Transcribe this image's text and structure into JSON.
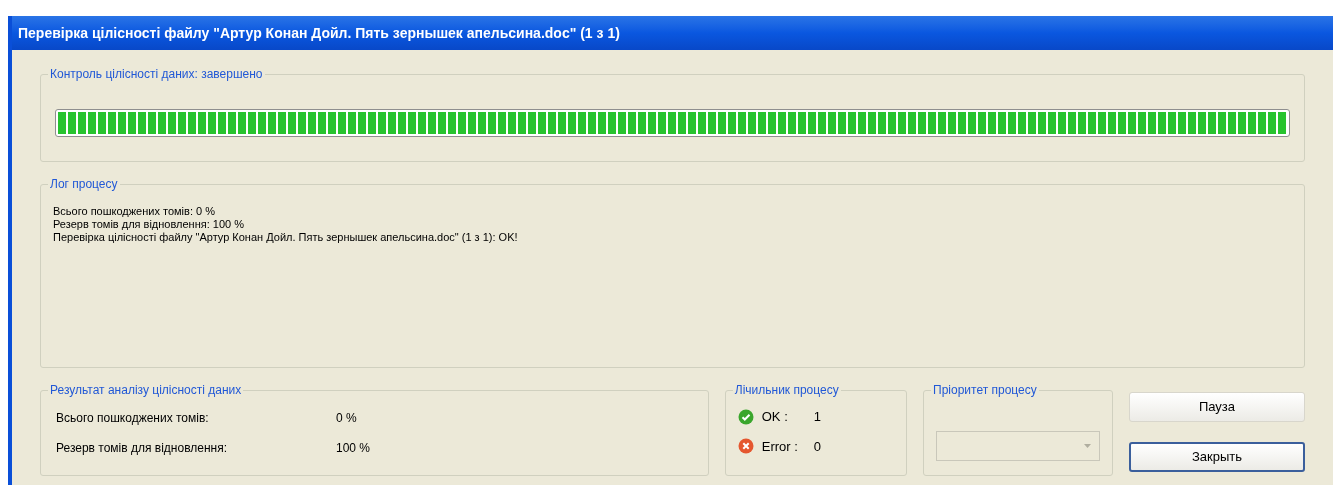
{
  "window": {
    "title": "Перевірка цілісності файлу \"Артур Конан Дойл. Пять зернышек апельсина.doc\" (1 з 1)"
  },
  "progress": {
    "label": "Контроль цілісності даних: завершено",
    "level": 1
  },
  "log": {
    "label": "Лог процесу",
    "lines": [
      "Всього пошкоджених томів: 0 %",
      "Резерв томів для відновлення: 100 %",
      "Перевірка цілісності файлу \"Артур Конан Дойл. Пять зернышек апельсина.doc\" (1 з 1): OK!"
    ]
  },
  "result": {
    "label": "Результат аналізу цілісності даних",
    "rows": [
      {
        "name": "Всього пошкоджених томів:",
        "value": "0 %"
      },
      {
        "name": "Резерв томів для відновлення:",
        "value": "100 %"
      }
    ]
  },
  "counter": {
    "label": "Лічильник процесу",
    "items": [
      {
        "kind": "ok",
        "name": "OK :",
        "value": "1"
      },
      {
        "kind": "error",
        "name": "Error :",
        "value": "0"
      }
    ]
  },
  "priority": {
    "label": "Пріоритет процесу",
    "disabled": true
  },
  "buttons": [
    {
      "label": "Пауза",
      "default": false
    },
    {
      "label": "Закрыть",
      "default": true
    }
  ]
}
